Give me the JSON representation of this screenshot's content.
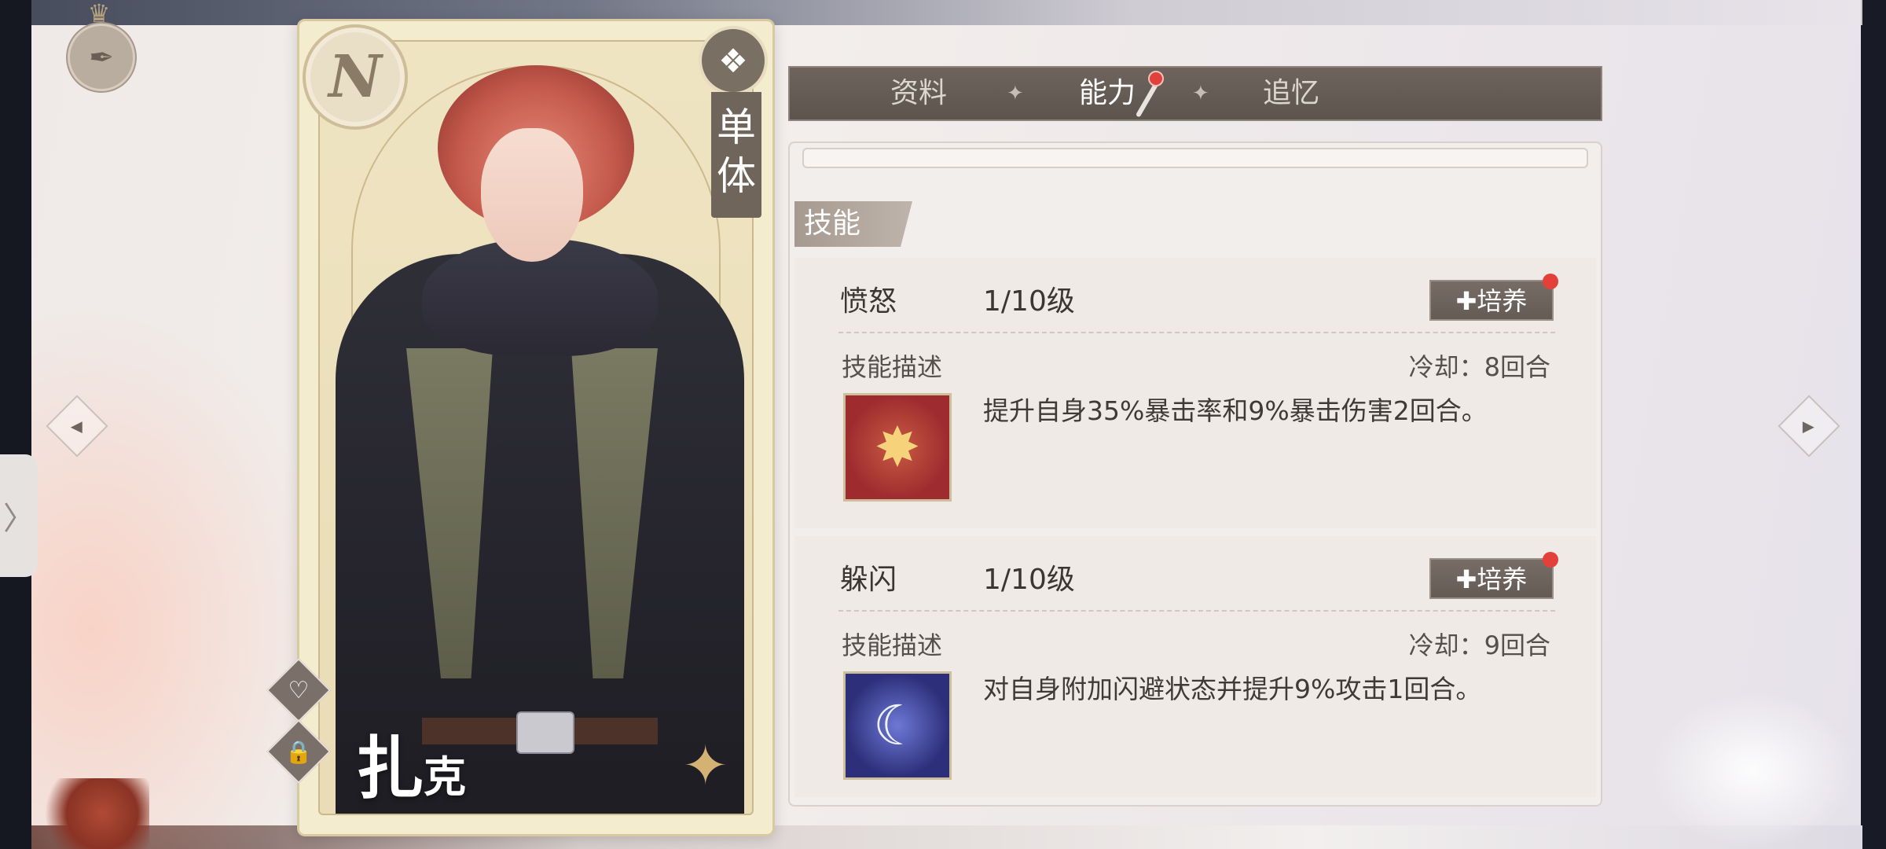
{
  "card": {
    "rarity": "N",
    "target_type": "单体",
    "name_main": "扎",
    "name_sub": "克",
    "icons": [
      "heart-icon",
      "lock-icon"
    ]
  },
  "tabs": [
    {
      "label": "资料",
      "active": false
    },
    {
      "label": "能力",
      "active": true,
      "has_notification": true
    },
    {
      "label": "追忆",
      "active": false
    }
  ],
  "section": {
    "title": "技能"
  },
  "skills": [
    {
      "name": "愤怒",
      "level": "1/10级",
      "train_label": "培养",
      "desc_label": "技能描述",
      "cooldown": "冷却：8回合",
      "description": "提升自身35%暴击率和9%暴击伤害2回合。",
      "icon": "sparkle-star-icon",
      "icon_color": "#9e2c2f"
    },
    {
      "name": "躲闪",
      "level": "1/10级",
      "train_label": "培养",
      "desc_label": "技能描述",
      "cooldown": "冷却：9回合",
      "description": "对自身附加闪避状态并提升9%攻击1回合。",
      "icon": "cat-leap-icon",
      "icon_color": "#2e2f7a"
    }
  ],
  "colors": {
    "accent_dark": "#6e645d",
    "notification": "#e0413b",
    "card_gold": "#d8c9a2"
  }
}
